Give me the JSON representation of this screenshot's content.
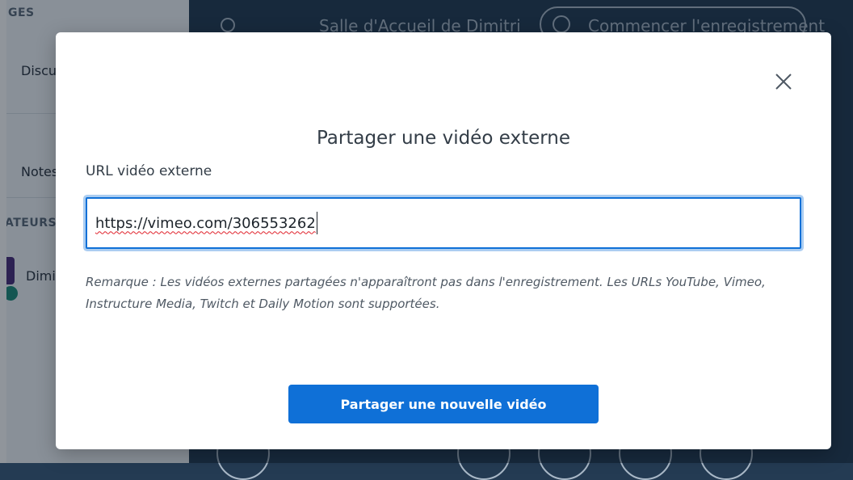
{
  "background": {
    "sidebar": {
      "section_messages": "GES",
      "item_discussion": "Discu",
      "item_notes": "Notes",
      "section_users": "ATEURS",
      "user_name": "Dimi"
    },
    "topbar": {
      "meeting_name": "Salle d'Accueil de Dimitri",
      "record_label": "Commencer l'enregistrement"
    }
  },
  "modal": {
    "title": "Partager une vidéo externe",
    "close_icon": "close-icon",
    "url_label": "URL vidéo externe",
    "url_value": "https://vimeo.com/306553262",
    "note": "Remarque : Les vidéos externes partagées n'apparaîtront pas dans l'enregistrement. Les URLs YouTube, Vimeo, Instructure Media, Twitch et Daily Motion sont supportées.",
    "share_button": "Partager une nouvelle vidéo"
  },
  "colors": {
    "accent": "#0f70d7",
    "topbar": "#243b53",
    "sidebar": "#f3f6f9"
  }
}
